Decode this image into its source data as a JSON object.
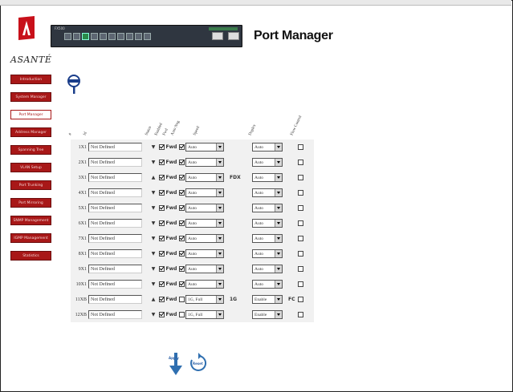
{
  "brand": {
    "name": "ASANTÉ"
  },
  "page_title": "Port Manager",
  "switch_label": "FX500",
  "nav": [
    {
      "label": "Introduction",
      "active": false
    },
    {
      "label": "System Manager",
      "active": false
    },
    {
      "label": "Port Manager",
      "active": true
    },
    {
      "label": "Address Manager",
      "active": false
    },
    {
      "label": "Spanning Tree",
      "active": false
    },
    {
      "label": "VLAN Setup",
      "active": false
    },
    {
      "label": "Port Trunking",
      "active": false
    },
    {
      "label": "Port Mirroring",
      "active": false
    },
    {
      "label": "SNMP Management",
      "active": false
    },
    {
      "label": "IGMP Management",
      "active": false
    },
    {
      "label": "Statistics",
      "active": false
    }
  ],
  "columns": [
    "#",
    "Id",
    "Status",
    "Enabled",
    "Fwd",
    "Auto Neg",
    "Speed",
    "Duplex",
    "Flow Control"
  ],
  "colors": {
    "nav_bg": "#a81818",
    "link_down": "#d02020",
    "link_up": "#18a020",
    "fwd": "#18a020"
  },
  "rows": [
    {
      "port": "1X1",
      "name": "Not Defined",
      "status": "down",
      "enabled": true,
      "fwd": "Fwd",
      "auto": true,
      "speed": "Auto",
      "speed_ind": "",
      "duplex": "Auto",
      "duplex_ind": "",
      "flow": false
    },
    {
      "port": "2X1",
      "name": "Not Defined",
      "status": "down",
      "enabled": true,
      "fwd": "Fwd",
      "auto": true,
      "speed": "Auto",
      "speed_ind": "",
      "duplex": "Auto",
      "duplex_ind": "",
      "flow": false
    },
    {
      "port": "3X1",
      "name": "Not Defined",
      "status": "up",
      "enabled": true,
      "fwd": "Fwd",
      "auto": true,
      "speed": "Auto",
      "speed_ind": "FDX",
      "duplex": "Auto",
      "duplex_ind": "",
      "flow": false
    },
    {
      "port": "4X1",
      "name": "Not Defined",
      "status": "down",
      "enabled": true,
      "fwd": "Fwd",
      "auto": true,
      "speed": "Auto",
      "speed_ind": "",
      "duplex": "Auto",
      "duplex_ind": "",
      "flow": false
    },
    {
      "port": "5X1",
      "name": "Not Defined",
      "status": "down",
      "enabled": true,
      "fwd": "Fwd",
      "auto": true,
      "speed": "Auto",
      "speed_ind": "",
      "duplex": "Auto",
      "duplex_ind": "",
      "flow": false
    },
    {
      "port": "6X1",
      "name": "Not Defined",
      "status": "down",
      "enabled": true,
      "fwd": "Fwd",
      "auto": true,
      "speed": "Auto",
      "speed_ind": "",
      "duplex": "Auto",
      "duplex_ind": "",
      "flow": false
    },
    {
      "port": "7X1",
      "name": "Not Defined",
      "status": "down",
      "enabled": true,
      "fwd": "Fwd",
      "auto": true,
      "speed": "Auto",
      "speed_ind": "",
      "duplex": "Auto",
      "duplex_ind": "",
      "flow": false
    },
    {
      "port": "8X1",
      "name": "Not Defined",
      "status": "down",
      "enabled": true,
      "fwd": "Fwd",
      "auto": true,
      "speed": "Auto",
      "speed_ind": "",
      "duplex": "Auto",
      "duplex_ind": "",
      "flow": false
    },
    {
      "port": "9X1",
      "name": "Not Defined",
      "status": "down",
      "enabled": true,
      "fwd": "Fwd",
      "auto": true,
      "speed": "Auto",
      "speed_ind": "",
      "duplex": "Auto",
      "duplex_ind": "",
      "flow": false
    },
    {
      "port": "10X1",
      "name": "Not Defined",
      "status": "down",
      "enabled": true,
      "fwd": "Fwd",
      "auto": true,
      "speed": "Auto",
      "speed_ind": "",
      "duplex": "Auto",
      "duplex_ind": "",
      "flow": false
    },
    {
      "port": "11XB",
      "name": "Not Defined",
      "status": "up",
      "enabled": true,
      "fwd": "Fwd",
      "auto": false,
      "speed": "1G, Full",
      "speed_ind": "1G",
      "duplex": "Enable",
      "duplex_ind": "FC",
      "flow": false
    },
    {
      "port": "12XB",
      "name": "Not Defined",
      "status": "down",
      "enabled": true,
      "fwd": "Fwd",
      "auto": false,
      "speed": "1G, Full",
      "speed_ind": "",
      "duplex": "Enable",
      "duplex_ind": "",
      "flow": false
    }
  ],
  "actions": {
    "apply": "Apply",
    "reset": "Reset"
  }
}
